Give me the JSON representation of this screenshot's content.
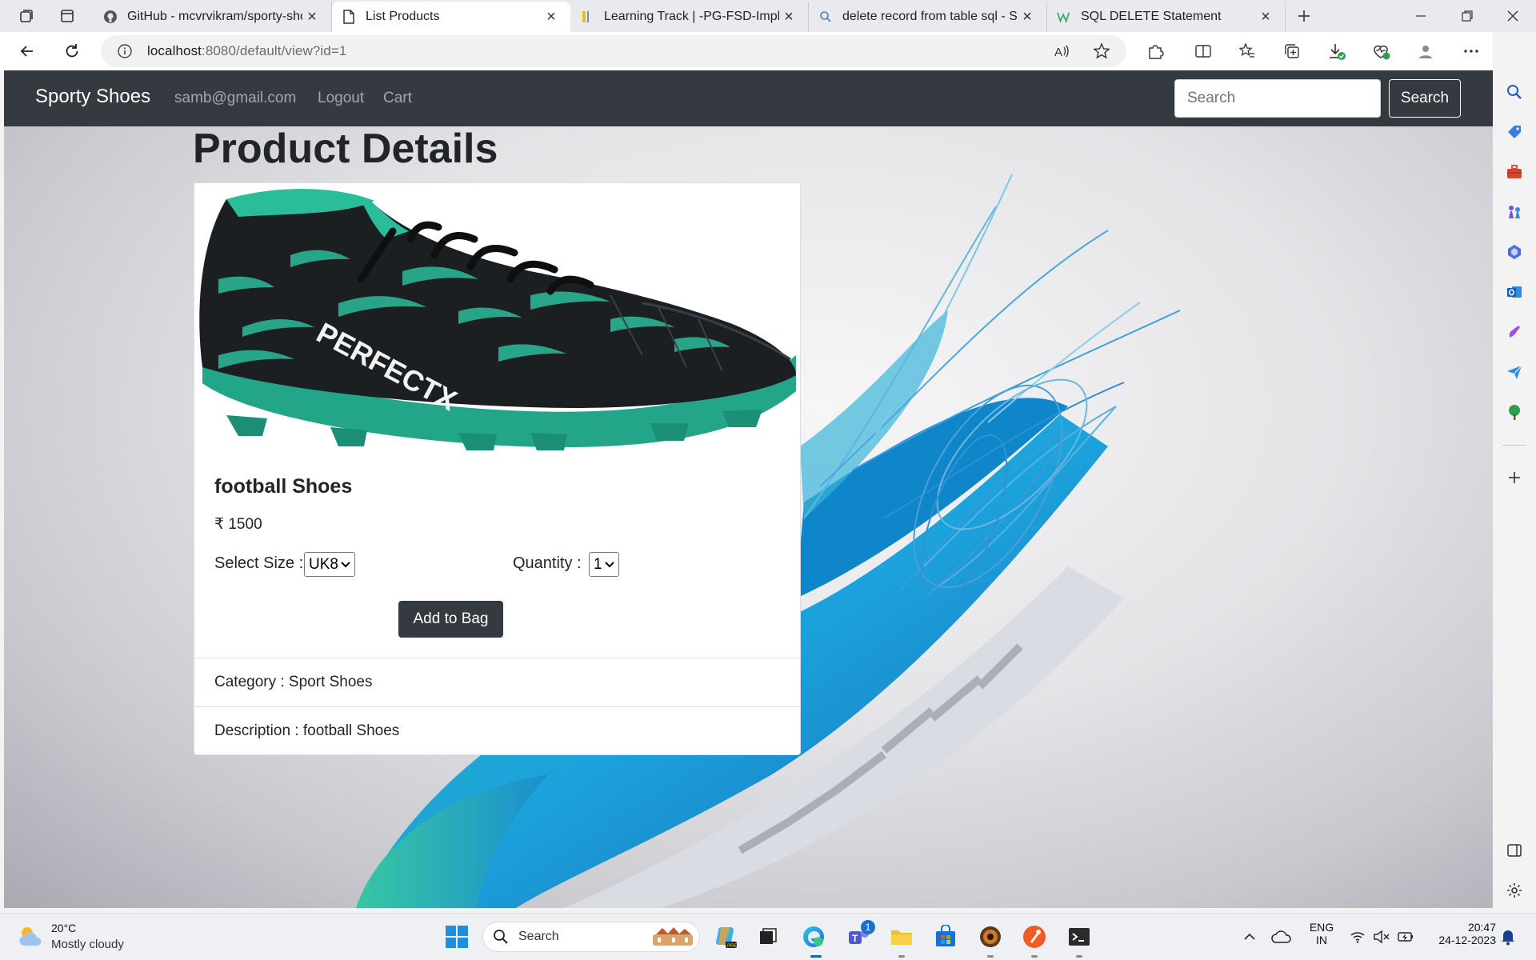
{
  "browser": {
    "tabs": [
      {
        "title": "GitHub - mcvrvikram/sporty-sho",
        "icon": "github-icon"
      },
      {
        "title": "List Products",
        "icon": "page-icon",
        "active": true
      },
      {
        "title": "Learning Track | -PG-FSD-Implem",
        "icon": "learning-icon"
      },
      {
        "title": "delete record from table sql - Se",
        "icon": "search-icon"
      },
      {
        "title": "SQL DELETE Statement",
        "icon": "w3schools-icon"
      }
    ],
    "url_host": "localhost",
    "url_rest": ":8080/default/view?id=1"
  },
  "site": {
    "brand": "Sporty Shoes",
    "nav": {
      "email": "samb@gmail.com",
      "logout": "Logout",
      "cart": "Cart"
    },
    "search": {
      "placeholder": "Search",
      "button": "Search"
    }
  },
  "page": {
    "title": "Product Details",
    "product": {
      "name": "football Shoes",
      "price": "₹ 1500",
      "image_text": "PERFECTX",
      "size_label": "Select Size :",
      "size_value": "UK8",
      "qty_label": "Quantity :",
      "qty_value": "1",
      "add_button": "Add to Bag",
      "category": "Category : Sport Shoes",
      "description": "Description : football Shoes"
    }
  },
  "taskbar": {
    "weather_temp": "20°C",
    "weather_desc": "Mostly cloudy",
    "search_label": "Search",
    "teams_badge": "1",
    "lang_line1": "ENG",
    "lang_line2": "IN",
    "time": "20:47",
    "date": "24-12-2023"
  },
  "colors": {
    "navbar": "#343a40",
    "button_dark": "#343a40",
    "shoe_green": "#2db38b",
    "shoe_blue": "#1d9fd6"
  }
}
